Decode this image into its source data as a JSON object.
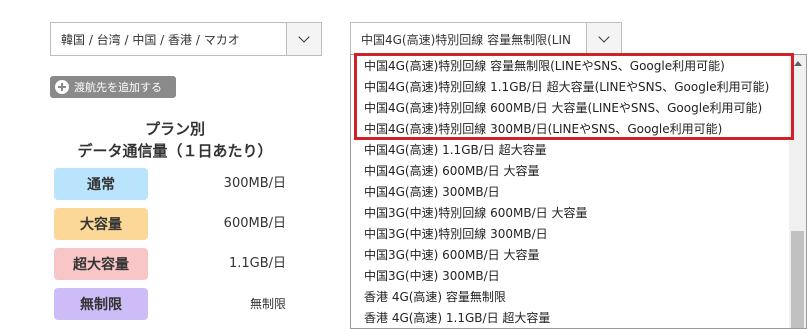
{
  "region_select": {
    "value": "韓国 / 台湾 / 中国 / 香港 / マカオ"
  },
  "plan_select": {
    "value": "中国4G(高速)特別回線 容量無制限(LIN"
  },
  "add_destination": {
    "label": "渡航先を追加する"
  },
  "plan_title": {
    "line1": "プラン別",
    "line2": "データ通信量（１日あたり）"
  },
  "tiers": [
    {
      "label": "通常",
      "value": "300MB/日",
      "color": "#b9e4fb"
    },
    {
      "label": "大容量",
      "value": "600MB/日",
      "color": "#fbd898"
    },
    {
      "label": "超大容量",
      "value": "1.1GB/日",
      "color": "#f8c6c7"
    },
    {
      "label": "無制限",
      "value": "無制限",
      "color": "#cdbcf7"
    }
  ],
  "dropdown": {
    "options": [
      "中国4G(高速)特別回線 容量無制限(LINEやSNS、Google利用可能)",
      "中国4G(高速)特別回線 1.1GB/日 超大容量(LINEやSNS、Google利用可能)",
      "中国4G(高速)特別回線 600MB/日 大容量(LINEやSNS、Google利用可能)",
      "中国4G(高速)特別回線 300MB/日(LINEやSNS、Google利用可能)",
      "中国4G(高速) 1.1GB/日 超大容量",
      "中国4G(高速) 600MB/日 大容量",
      "中国4G(高速) 300MB/日",
      "中国3G(中速)特別回線 600MB/日 大容量",
      "中国3G(中速)特別回線 300MB/日",
      "中国3G(中速) 600MB/日 大容量",
      "中国3G(中速) 300MB/日",
      "香港 4G(高速) 容量無制限",
      "香港 4G(高速) 1.1GB/日 超大容量"
    ],
    "highlight_color": "#d0202a"
  }
}
